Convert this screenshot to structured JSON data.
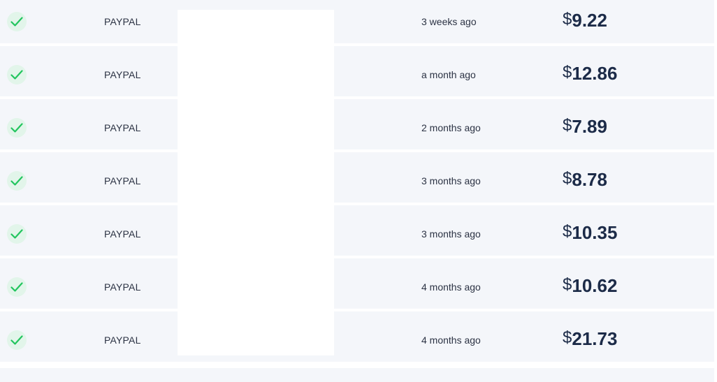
{
  "colors": {
    "row_bg": "#f4f6fa",
    "check": "#22c55e",
    "check_bg": "#e2f5ea",
    "amount_text": "#1c2b48"
  },
  "transactions": [
    {
      "status_icon": "check-icon",
      "method": "PAYPAL",
      "time": "3 weeks ago",
      "currency": "$",
      "amount": "9.22"
    },
    {
      "status_icon": "check-icon",
      "method": "PAYPAL",
      "time": "a month ago",
      "currency": "$",
      "amount": "12.86"
    },
    {
      "status_icon": "check-icon",
      "method": "PAYPAL",
      "time": "2 months ago",
      "currency": "$",
      "amount": "7.89"
    },
    {
      "status_icon": "check-icon",
      "method": "PAYPAL",
      "time": "3 months ago",
      "currency": "$",
      "amount": "8.78"
    },
    {
      "status_icon": "check-icon",
      "method": "PAYPAL",
      "time": "3 months ago",
      "currency": "$",
      "amount": "10.35"
    },
    {
      "status_icon": "check-icon",
      "method": "PAYPAL",
      "time": "4 months ago",
      "currency": "$",
      "amount": "10.62"
    },
    {
      "status_icon": "check-icon",
      "method": "PAYPAL",
      "time": "4 months ago",
      "currency": "$",
      "amount": "21.73"
    }
  ]
}
